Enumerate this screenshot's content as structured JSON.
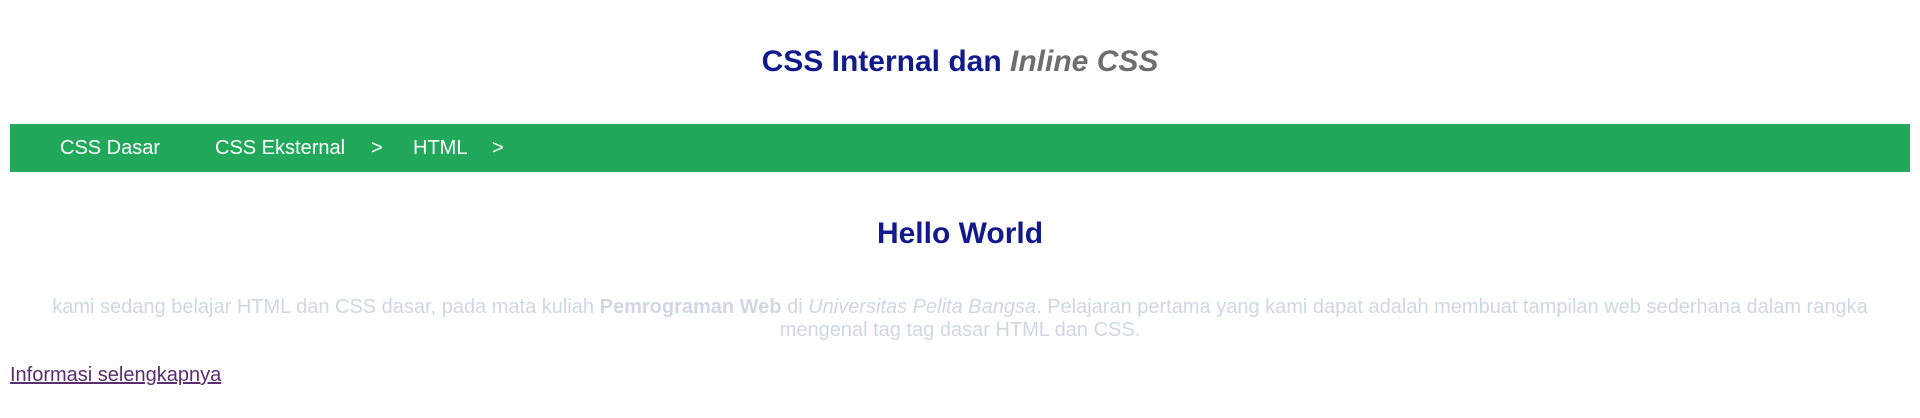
{
  "header": {
    "title_plain": "CSS Internal dan ",
    "title_italic": "Inline CSS"
  },
  "nav": {
    "items": [
      {
        "label": "CSS Dasar"
      },
      {
        "label": "CSS Eksternal"
      },
      {
        "label": "HTML"
      }
    ],
    "separator": ">"
  },
  "main": {
    "heading": "Hello World",
    "paragraph": {
      "part1": "kami sedang belajar HTML dan CSS dasar, pada mata kuliah ",
      "bold": "Pemrograman Web",
      "part2": " di ",
      "italic": "Universitas Pelita Bangsa",
      "part3": ". Pelajaran pertama yang kami dapat adalah membuat tampilan web sederhana dalam rangka mengenal tag tag dasar HTML dan CSS."
    },
    "link_label": "Informasi selengkapnya"
  },
  "colors": {
    "heading": "#12198a",
    "title_italic": "#6e6e6e",
    "navbar_bg": "#22a85b",
    "nav_text": "#ffffff",
    "paragraph_text": "#cfd8e2",
    "link": "#5a2d6e"
  }
}
